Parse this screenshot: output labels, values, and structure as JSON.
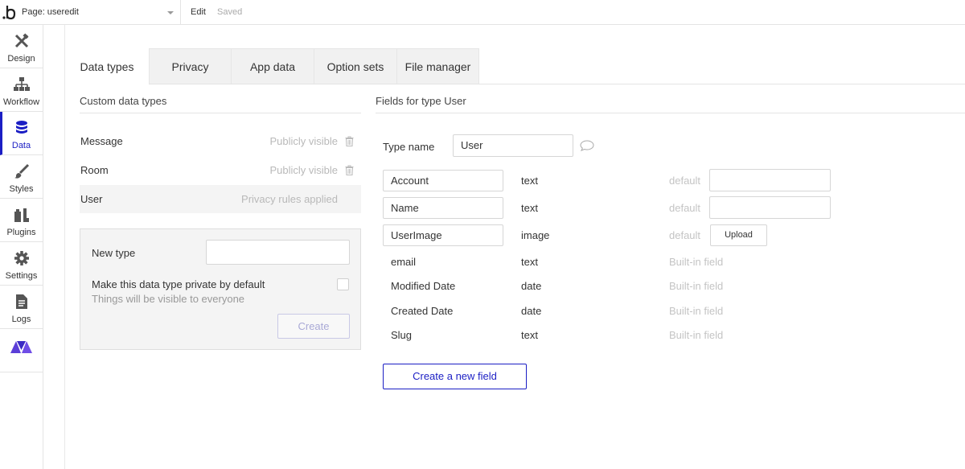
{
  "topbar": {
    "page_label": "Page: useredit",
    "edit_label": "Edit",
    "saved_label": "Saved"
  },
  "sidebar": {
    "items": [
      {
        "label": "Design",
        "icon": "design-icon"
      },
      {
        "label": "Workflow",
        "icon": "workflow-icon"
      },
      {
        "label": "Data",
        "icon": "database-icon",
        "active": true
      },
      {
        "label": "Styles",
        "icon": "brush-icon"
      },
      {
        "label": "Plugins",
        "icon": "plugins-icon"
      },
      {
        "label": "Settings",
        "icon": "gear-icon"
      },
      {
        "label": "Logs",
        "icon": "document-icon"
      },
      {
        "label": "",
        "icon": "brand-icon"
      }
    ],
    "active_color": "#1b1ec4"
  },
  "tabs": [
    {
      "label": "Data types",
      "active": true
    },
    {
      "label": "Privacy"
    },
    {
      "label": "App data"
    },
    {
      "label": "Option sets"
    },
    {
      "label": "File manager"
    }
  ],
  "left": {
    "section_title": "Custom data types",
    "types": [
      {
        "name": "Message",
        "status": "Publicly visible",
        "trash": true
      },
      {
        "name": "Room",
        "status": "Publicly visible",
        "trash": true
      },
      {
        "name": "User",
        "status": "Privacy rules applied",
        "selected": true
      }
    ],
    "new_type": {
      "label": "New type",
      "input_value": "",
      "private_label": "Make this data type private by default",
      "hint": "Things will be visible to everyone",
      "create_label": "Create"
    }
  },
  "right": {
    "section_title": "Fields for type User",
    "type_name_label": "Type name",
    "type_name_value": "User",
    "fields": [
      {
        "name": "Account",
        "type": "text",
        "editable": true,
        "default_label": "default",
        "default_kind": "input"
      },
      {
        "name": "Name",
        "type": "text",
        "editable": true,
        "default_label": "default",
        "default_kind": "input"
      },
      {
        "name": "UserImage",
        "type": "image",
        "editable": true,
        "default_label": "default",
        "default_kind": "upload",
        "upload_label": "Upload"
      },
      {
        "name": "email",
        "type": "text",
        "builtin": "Built-in field"
      },
      {
        "name": "Modified Date",
        "type": "date",
        "builtin": "Built-in field"
      },
      {
        "name": "Created Date",
        "type": "date",
        "builtin": "Built-in field"
      },
      {
        "name": "Slug",
        "type": "text",
        "builtin": "Built-in field"
      }
    ],
    "create_field_label": "Create a new field"
  }
}
